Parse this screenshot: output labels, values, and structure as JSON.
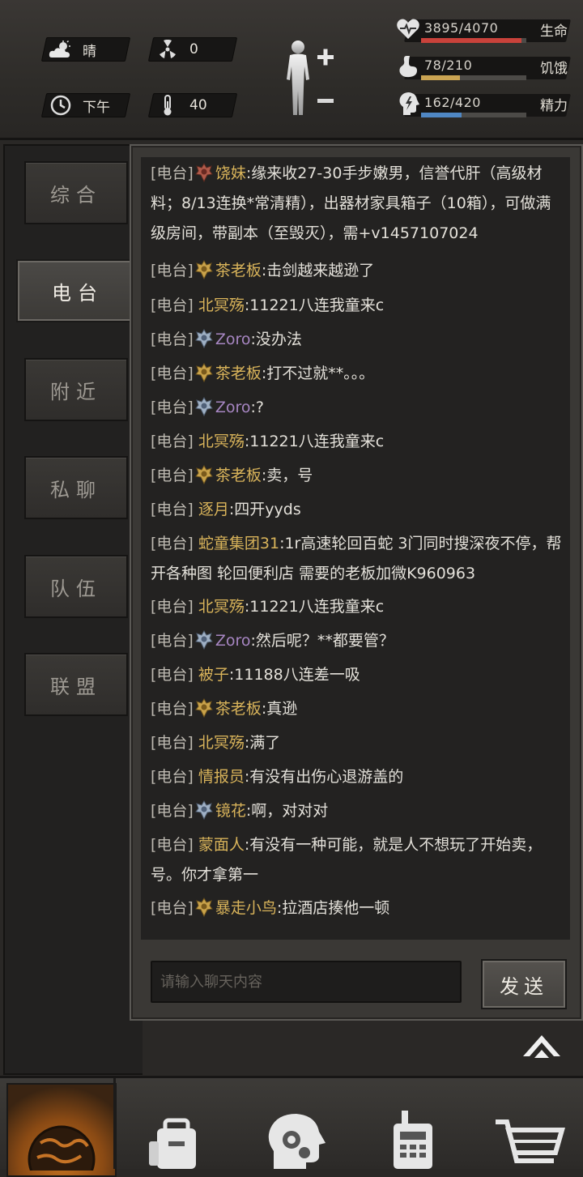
{
  "status": {
    "weather": "晴",
    "radiation": "0",
    "time_of_day": "下午",
    "temperature": "40"
  },
  "stats": [
    {
      "icon": "heart-icon",
      "value": "3895/4070",
      "label": "生命",
      "fraction": 0.957,
      "color": "#c9423b"
    },
    {
      "icon": "stomach-icon",
      "value": "78/210",
      "label": "饥饿",
      "fraction": 0.371,
      "color": "#c9a352"
    },
    {
      "icon": "energy-icon",
      "value": "162/420",
      "label": "精力",
      "fraction": 0.386,
      "color": "#4f87c4"
    }
  ],
  "tabs": [
    "综合",
    "电台",
    "附近",
    "私聊",
    "队伍",
    "联盟"
  ],
  "active_tab": "电台",
  "messages": [
    {
      "tag": "[电台]",
      "badge": "red",
      "name": "饶妹",
      "name_class": "",
      "text": ":缘来收27-30手步嫩男，信誉代肝（高级材料；8/13连换*常清精），出器材家具箱子（10箱），可做满级房间，带副本（至毁灭），需+v1457107024"
    },
    {
      "tag": "[电台]",
      "badge": "gold",
      "name": "茶老板",
      "name_class": "",
      "text": ":击剑越来越逊了"
    },
    {
      "tag": "[电台]",
      "badge": "",
      "name": "北冥殇",
      "name_class": "",
      "text": ":11221八连我童来c"
    },
    {
      "tag": "[电台]",
      "badge": "silver",
      "name": "Zoro",
      "name_class": "zoro",
      "text": ":没办法"
    },
    {
      "tag": "[电台]",
      "badge": "gold",
      "name": "茶老板",
      "name_class": "",
      "text": ":打不过就**。。。"
    },
    {
      "tag": "[电台]",
      "badge": "silver",
      "name": "Zoro",
      "name_class": "zoro",
      "text": ":?"
    },
    {
      "tag": "[电台]",
      "badge": "",
      "name": "北冥殇",
      "name_class": "",
      "text": ":11221八连我童来c"
    },
    {
      "tag": "[电台]",
      "badge": "gold",
      "name": "茶老板",
      "name_class": "",
      "text": ":卖，号"
    },
    {
      "tag": "[电台]",
      "badge": "",
      "name": "逐月",
      "name_class": "",
      "text": ":四开yyds"
    },
    {
      "tag": "[电台]",
      "badge": "",
      "name": "蛇童集团31",
      "name_class": "",
      "text": ":1r高速轮回百蛇 3门同时搜深夜不停，帮开各种图 轮回便利店 需要的老板加微K960963"
    },
    {
      "tag": "[电台]",
      "badge": "",
      "name": "北冥殇",
      "name_class": "",
      "text": ":11221八连我童来c"
    },
    {
      "tag": "[电台]",
      "badge": "silver",
      "name": "Zoro",
      "name_class": "zoro",
      "text": ":然后呢？**都要管？"
    },
    {
      "tag": "[电台]",
      "badge": "",
      "name": "被子",
      "name_class": "",
      "text": ":11188八连差一吸"
    },
    {
      "tag": "[电台]",
      "badge": "gold",
      "name": "茶老板",
      "name_class": "",
      "text": ":真逊"
    },
    {
      "tag": "[电台]",
      "badge": "",
      "name": "北冥殇",
      "name_class": "",
      "text": ":满了"
    },
    {
      "tag": "[电台]",
      "badge": "",
      "name": "情报员",
      "name_class": "",
      "text": ":有没有出伤心退游盖的"
    },
    {
      "tag": "[电台]",
      "badge": "silver",
      "name": "镜花",
      "name_class": "",
      "text": ":啊，对对对"
    },
    {
      "tag": "[电台]",
      "badge": "",
      "name": "蒙面人",
      "name_class": "",
      "text": ":有没有一种可能，就是人不想玩了开始卖，号。你才拿第一"
    },
    {
      "tag": "[电台]",
      "badge": "gold",
      "name": "暴走小鸟",
      "name_class": "",
      "text": ":拉酒店揍他一顿"
    }
  ],
  "input": {
    "placeholder": "请输入聊天内容",
    "value": ""
  },
  "send_label": "发送",
  "bottom_nav": [
    "world-map",
    "backpack",
    "skills",
    "radio",
    "shop"
  ]
}
